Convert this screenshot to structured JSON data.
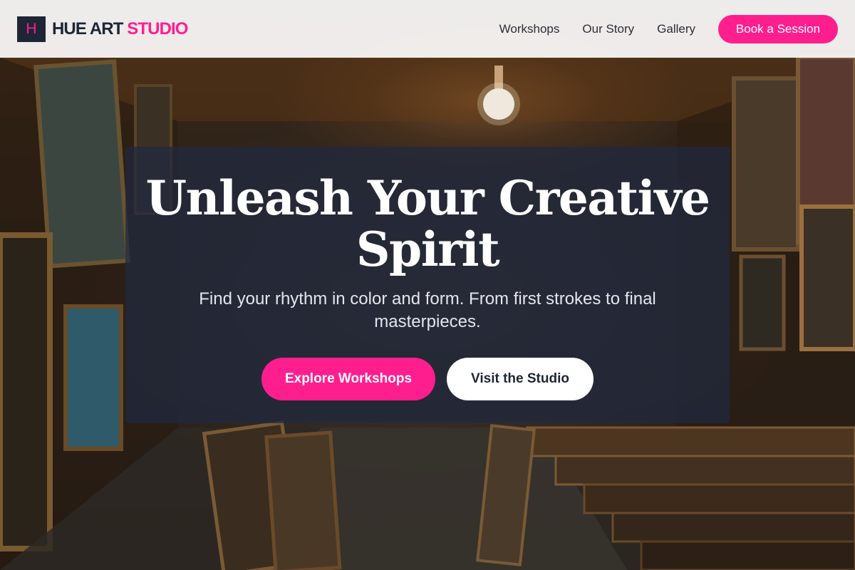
{
  "brand": {
    "mark": "H",
    "name_main": "HUE ART",
    "name_accent": "STUDIO"
  },
  "nav": {
    "items": [
      {
        "label": "Workshops"
      },
      {
        "label": "Our Story"
      },
      {
        "label": "Gallery"
      }
    ],
    "cta_label": "Book a Session"
  },
  "hero": {
    "title": "Unleash Your Creative Spirit",
    "subtitle": "Find your rhythm in color and form. From first strokes to final masterpieces.",
    "primary_label": "Explore Workshops",
    "secondary_label": "Visit the Studio"
  },
  "colors": {
    "accent": "#ff1e8e",
    "dark": "#1e2535",
    "header_bg": "#f7f6f5",
    "hero_overlay": "#20293e"
  },
  "icons": {
    "background": "art-storage-room-photo"
  }
}
